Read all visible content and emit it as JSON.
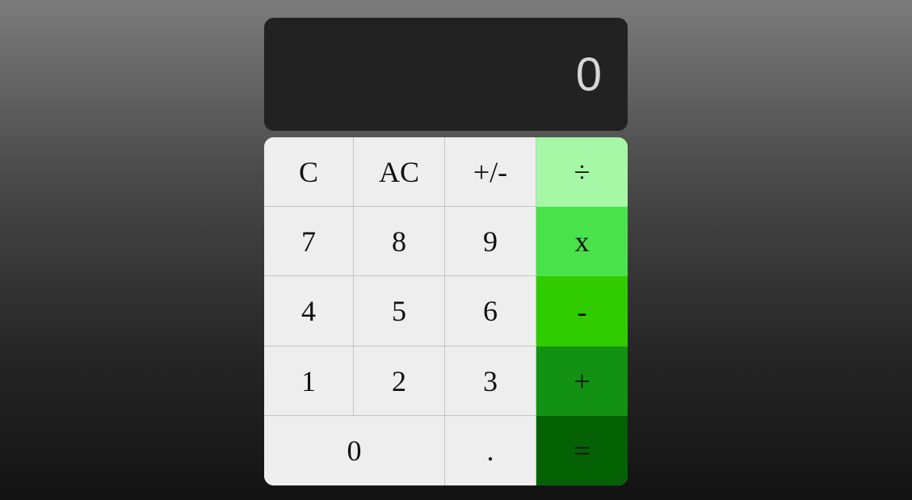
{
  "display": {
    "value": "0",
    "background": "#222222",
    "text_color": "#d6d6d6"
  },
  "keypad": {
    "rows": [
      [
        {
          "label": "C",
          "name": "clear-button"
        },
        {
          "label": "AC",
          "name": "all-clear-button"
        },
        {
          "label": "+/-",
          "name": "sign-toggle-button"
        },
        {
          "label": "÷",
          "name": "divide-button",
          "color": "#a6f7a6"
        }
      ],
      [
        {
          "label": "7",
          "name": "digit-7-button"
        },
        {
          "label": "8",
          "name": "digit-8-button"
        },
        {
          "label": "9",
          "name": "digit-9-button"
        },
        {
          "label": "x",
          "name": "multiply-button",
          "color": "#4ae24a"
        }
      ],
      [
        {
          "label": "4",
          "name": "digit-4-button"
        },
        {
          "label": "5",
          "name": "digit-5-button"
        },
        {
          "label": "6",
          "name": "digit-6-button"
        },
        {
          "label": "-",
          "name": "subtract-button",
          "color": "#30cc00"
        }
      ],
      [
        {
          "label": "1",
          "name": "digit-1-button"
        },
        {
          "label": "2",
          "name": "digit-2-button"
        },
        {
          "label": "3",
          "name": "digit-3-button"
        },
        {
          "label": "+",
          "name": "add-button",
          "color": "#129113"
        }
      ],
      [
        {
          "label": "0",
          "name": "digit-0-button"
        },
        {
          "label": ".",
          "name": "decimal-point-button"
        },
        {
          "label": "=",
          "name": "equals-button",
          "color": "#046104"
        }
      ]
    ],
    "key_background": "#eeeeee"
  }
}
